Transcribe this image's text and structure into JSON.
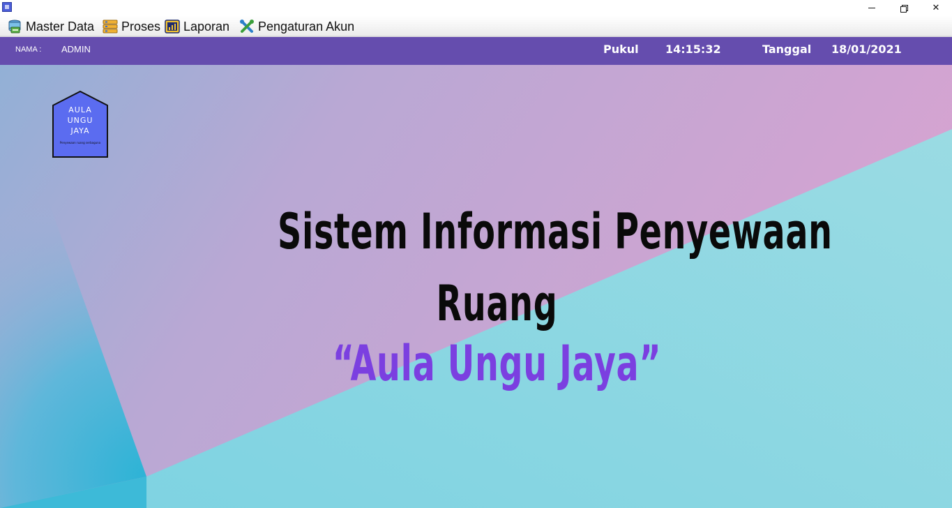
{
  "window": {
    "icon": "app-window-icon",
    "controls": [
      "minimize-icon",
      "restore-icon",
      "close-icon"
    ]
  },
  "menu": {
    "items": [
      {
        "label": "Master Data",
        "icon": "database-icon"
      },
      {
        "label": "Proses",
        "icon": "process-stack-icon"
      },
      {
        "label": "Laporan",
        "icon": "report-chart-icon"
      },
      {
        "label": "Pengaturan Akun",
        "icon": "tools-icon"
      }
    ]
  },
  "status": {
    "nama_label": "NAMA  :",
    "nama_value": "ADMIN",
    "pukul_label": "Pukul",
    "pukul_value": "14:15:32",
    "tanggal_label": "Tanggal",
    "tanggal_value": "18/01/2021"
  },
  "logo": {
    "line1": "AULA",
    "line2": "UNGU",
    "line3": "JAYA",
    "tagline": "Penyewaan ruang serbaguna"
  },
  "headline": {
    "line1": "Sistem Informasi Penyewaan",
    "line2": "Ruang",
    "line3": "“Aula Ungu Jaya”"
  },
  "colors": {
    "status_bar": "#654dae",
    "headline_accent": "#7b3fe0",
    "logo_fill": "#5b6cf0",
    "bg_pink": "#d0a3d2",
    "bg_teal": "#96dae2",
    "bg_blue": "#3fb2d8"
  }
}
